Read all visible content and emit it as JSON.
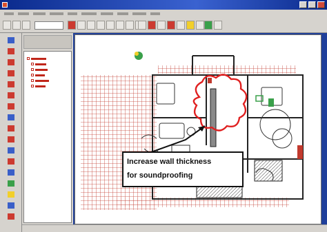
{
  "annotation": {
    "line1": "Increase wall thickness",
    "line2": "for soundproofing"
  },
  "icons": {
    "app": "cad-app-icon",
    "cloud": "revision-cloud-icon",
    "note": "markup-note-icon"
  },
  "colors": {
    "titlebar": "#0a2a8c",
    "chrome": "#d6d3ce",
    "markup_red": "#e02020",
    "plan_red": "#c23a2e",
    "accent_green": "#3aa04a"
  }
}
